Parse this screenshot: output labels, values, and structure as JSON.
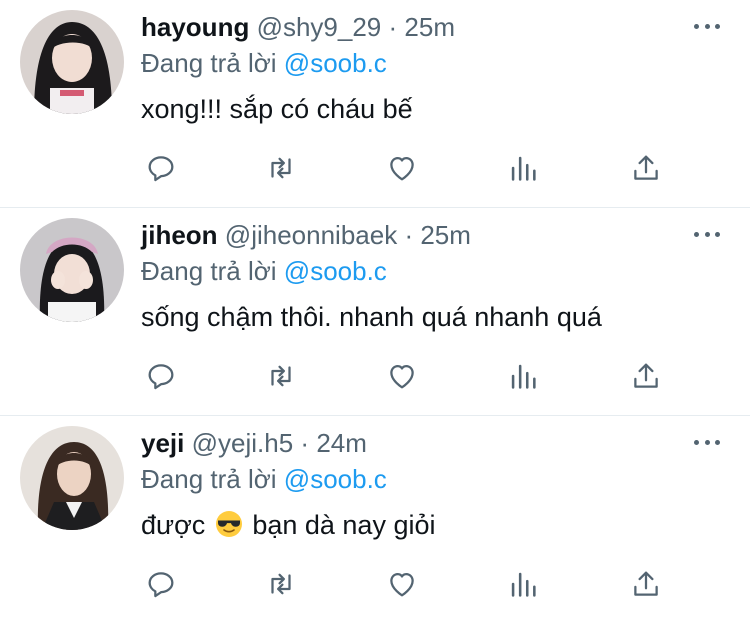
{
  "tweets": [
    {
      "display_name": "hayoung",
      "handle": "@shy9_29",
      "separator": "·",
      "time": "25m",
      "reply_prefix": "Đang trả lời",
      "reply_to": "@soob.c",
      "text": "xong!!! sắp có cháu bế"
    },
    {
      "display_name": "jiheon",
      "handle": "@jiheonnibaek",
      "separator": "·",
      "time": "25m",
      "reply_prefix": "Đang trả lời",
      "reply_to": "@soob.c",
      "text": "sống chậm thôi. nhanh quá nhanh quá"
    },
    {
      "display_name": "yeji",
      "handle": "@yeji.h5",
      "separator": "·",
      "time": "24m",
      "reply_prefix": "Đang trả lời",
      "reply_to": "@soob.c",
      "text_before": "được",
      "emoji": "smiling-face-with-sunglasses",
      "text_after": "bạn dà nay giỏi"
    }
  ],
  "icons": {
    "reply": "reply-icon",
    "retweet": "retweet-icon",
    "like": "heart-icon",
    "stats": "analytics-icon",
    "share": "share-icon",
    "more": "more-icon"
  },
  "colors": {
    "text": "#0f1419",
    "secondary": "#536471",
    "link": "#1d9bf0",
    "divider": "#e6ecf0"
  }
}
